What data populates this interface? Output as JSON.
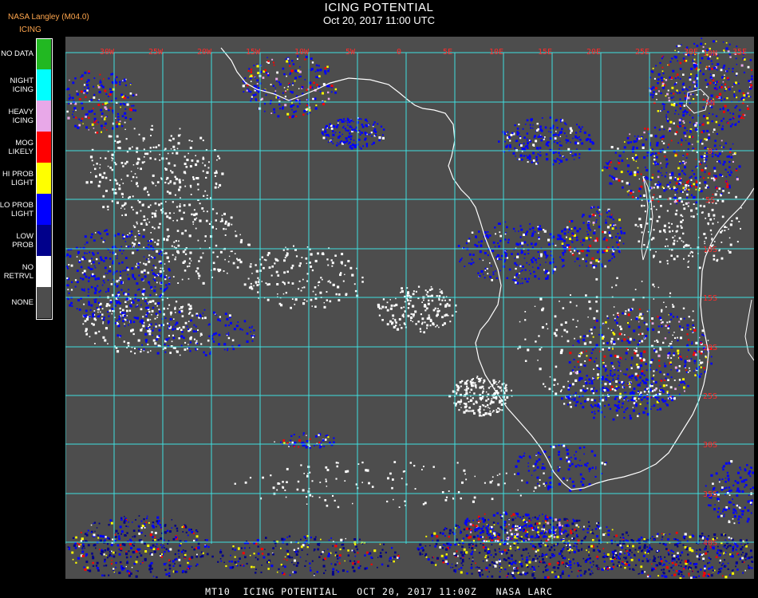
{
  "header": {
    "title": "ICING POTENTIAL",
    "subtitle": "Oct 20, 2017 11:00 UTC",
    "source": "NASA Langley (M04.0)",
    "legend_title": "ICING"
  },
  "legend": {
    "items": [
      {
        "label": "NO DATA",
        "color": "#22b822"
      },
      {
        "label": "NIGHT\nICING",
        "color": "#00ffff"
      },
      {
        "label": "HEAVY\nICING",
        "color": "#e8a8e8"
      },
      {
        "label": "MOG\nLIKELY",
        "color": "#ff0000"
      },
      {
        "label": "HI PROB\nLIGHT",
        "color": "#ffff00"
      },
      {
        "label": "LO PROB\nLIGHT",
        "color": "#0000ff"
      },
      {
        "label": "LOW\nPROB",
        "color": "#00008b"
      },
      {
        "label": "NO\nRETRVL",
        "color": "#ffffff"
      },
      {
        "label": "NONE",
        "color": "#4d4d4d"
      }
    ]
  },
  "map": {
    "background_color": "#4d4d4d",
    "grid_color": "#40e0e0",
    "coastline_color": "#ffffff",
    "label_color": "#ff2b2b",
    "longitude_labels": [
      "30W",
      "25W",
      "20W",
      "15W",
      "10W",
      "5W",
      "0",
      "5E",
      "10E",
      "15E",
      "20E",
      "25E",
      "30E",
      "35E"
    ],
    "latitude_labels": [
      "10N",
      "5N",
      "0",
      "5S",
      "10S",
      "15S",
      "20S",
      "25S",
      "30S",
      "35S",
      "40S"
    ]
  },
  "footer": {
    "text": "MT10  ICING POTENTIAL   OCT 20, 2017 11:00Z   NASA LARC"
  }
}
